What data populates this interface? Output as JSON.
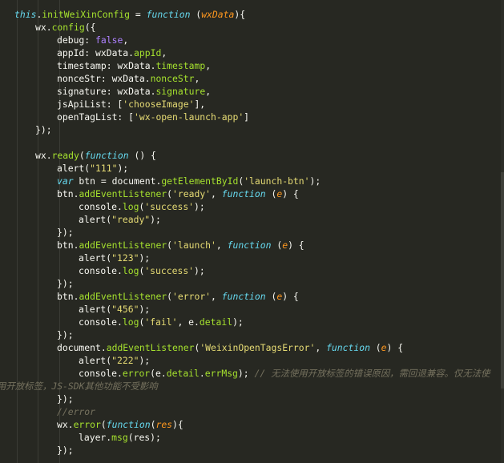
{
  "editor": {
    "theme_colors": {
      "background": "#272822",
      "keyword": "#66d9ef",
      "function": "#a6e22e",
      "string": "#e6db74",
      "boolean": "#ae81ff",
      "parameter": "#fd971f",
      "comment": "#75715e",
      "text": "#f8f8f2"
    },
    "lines": [
      {
        "indent": 0,
        "tokens": [
          [
            "kwi",
            "this"
          ],
          [
            "plain",
            "."
          ],
          [
            "fn",
            "initWeiXinConfig"
          ],
          [
            "plain",
            " = "
          ],
          [
            "kwi",
            "function"
          ],
          [
            "plain",
            " ("
          ],
          [
            "param",
            "wxData"
          ],
          [
            "plain",
            "){"
          ]
        ]
      },
      {
        "indent": 1,
        "tokens": [
          [
            "plain",
            "wx."
          ],
          [
            "fn",
            "config"
          ],
          [
            "plain",
            "({"
          ]
        ]
      },
      {
        "indent": 2,
        "tokens": [
          [
            "plain",
            "debug: "
          ],
          [
            "bool",
            "false"
          ],
          [
            "plain",
            ","
          ]
        ]
      },
      {
        "indent": 2,
        "tokens": [
          [
            "plain",
            "appId: wxData."
          ],
          [
            "prop",
            "appId"
          ],
          [
            "plain",
            ","
          ]
        ]
      },
      {
        "indent": 2,
        "tokens": [
          [
            "plain",
            "timestamp: wxData."
          ],
          [
            "prop",
            "timestamp"
          ],
          [
            "plain",
            ","
          ]
        ]
      },
      {
        "indent": 2,
        "tokens": [
          [
            "plain",
            "nonceStr: wxData."
          ],
          [
            "prop",
            "nonceStr"
          ],
          [
            "plain",
            ","
          ]
        ]
      },
      {
        "indent": 2,
        "tokens": [
          [
            "plain",
            "signature: wxData."
          ],
          [
            "prop",
            "signature"
          ],
          [
            "plain",
            ","
          ]
        ]
      },
      {
        "indent": 2,
        "tokens": [
          [
            "plain",
            "jsApiList: ["
          ],
          [
            "str",
            "'chooseImage'"
          ],
          [
            "plain",
            "],"
          ]
        ]
      },
      {
        "indent": 2,
        "tokens": [
          [
            "plain",
            "openTagList: ["
          ],
          [
            "str",
            "'wx-open-launch-app'"
          ],
          [
            "plain",
            "]"
          ]
        ]
      },
      {
        "indent": 1,
        "tokens": [
          [
            "plain",
            "});"
          ]
        ]
      },
      {
        "indent": 0,
        "tokens": []
      },
      {
        "indent": 1,
        "tokens": [
          [
            "plain",
            "wx."
          ],
          [
            "fn",
            "ready"
          ],
          [
            "plain",
            "("
          ],
          [
            "kwi",
            "function"
          ],
          [
            "plain",
            " () {"
          ]
        ]
      },
      {
        "indent": 2,
        "tokens": [
          [
            "plain",
            "alert("
          ],
          [
            "str",
            "\"111\""
          ],
          [
            "plain",
            ");"
          ]
        ]
      },
      {
        "indent": 2,
        "tokens": [
          [
            "kwi",
            "var"
          ],
          [
            "plain",
            " btn = document."
          ],
          [
            "fn",
            "getElementById"
          ],
          [
            "plain",
            "("
          ],
          [
            "str",
            "'launch-btn'"
          ],
          [
            "plain",
            ");"
          ]
        ]
      },
      {
        "indent": 2,
        "tokens": [
          [
            "plain",
            "btn."
          ],
          [
            "fn",
            "addEventListener"
          ],
          [
            "plain",
            "("
          ],
          [
            "str",
            "'ready'"
          ],
          [
            "plain",
            ", "
          ],
          [
            "kwi",
            "function"
          ],
          [
            "plain",
            " ("
          ],
          [
            "param",
            "e"
          ],
          [
            "plain",
            ") {"
          ]
        ]
      },
      {
        "indent": 3,
        "tokens": [
          [
            "plain",
            "console."
          ],
          [
            "fn",
            "log"
          ],
          [
            "plain",
            "("
          ],
          [
            "str",
            "'success'"
          ],
          [
            "plain",
            ");"
          ]
        ]
      },
      {
        "indent": 3,
        "tokens": [
          [
            "plain",
            "alert("
          ],
          [
            "str",
            "\"ready\""
          ],
          [
            "plain",
            ");"
          ]
        ]
      },
      {
        "indent": 2,
        "tokens": [
          [
            "plain",
            "});"
          ]
        ]
      },
      {
        "indent": 2,
        "tokens": [
          [
            "plain",
            "btn."
          ],
          [
            "fn",
            "addEventListener"
          ],
          [
            "plain",
            "("
          ],
          [
            "str",
            "'launch'"
          ],
          [
            "plain",
            ", "
          ],
          [
            "kwi",
            "function"
          ],
          [
            "plain",
            " ("
          ],
          [
            "param",
            "e"
          ],
          [
            "plain",
            ") {"
          ]
        ]
      },
      {
        "indent": 3,
        "tokens": [
          [
            "plain",
            "alert("
          ],
          [
            "str",
            "\"123\""
          ],
          [
            "plain",
            ");"
          ]
        ]
      },
      {
        "indent": 3,
        "tokens": [
          [
            "plain",
            "console."
          ],
          [
            "fn",
            "log"
          ],
          [
            "plain",
            "("
          ],
          [
            "str",
            "'success'"
          ],
          [
            "plain",
            ");"
          ]
        ]
      },
      {
        "indent": 2,
        "tokens": [
          [
            "plain",
            "});"
          ]
        ]
      },
      {
        "indent": 2,
        "tokens": [
          [
            "plain",
            "btn."
          ],
          [
            "fn",
            "addEventListener"
          ],
          [
            "plain",
            "("
          ],
          [
            "str",
            "'error'"
          ],
          [
            "plain",
            ", "
          ],
          [
            "kwi",
            "function"
          ],
          [
            "plain",
            " ("
          ],
          [
            "param",
            "e"
          ],
          [
            "plain",
            ") {"
          ]
        ]
      },
      {
        "indent": 3,
        "tokens": [
          [
            "plain",
            "alert("
          ],
          [
            "str",
            "\"456\""
          ],
          [
            "plain",
            ");"
          ]
        ]
      },
      {
        "indent": 3,
        "tokens": [
          [
            "plain",
            "console."
          ],
          [
            "fn",
            "log"
          ],
          [
            "plain",
            "("
          ],
          [
            "str",
            "'fail'"
          ],
          [
            "plain",
            ", e."
          ],
          [
            "prop",
            "detail"
          ],
          [
            "plain",
            ");"
          ]
        ]
      },
      {
        "indent": 2,
        "tokens": [
          [
            "plain",
            "});"
          ]
        ]
      },
      {
        "indent": 2,
        "tokens": [
          [
            "plain",
            "document."
          ],
          [
            "fn",
            "addEventListener"
          ],
          [
            "plain",
            "("
          ],
          [
            "str",
            "'WeixinOpenTagsError'"
          ],
          [
            "plain",
            ", "
          ],
          [
            "kwi",
            "function"
          ],
          [
            "plain",
            " ("
          ],
          [
            "param",
            "e"
          ],
          [
            "plain",
            ") {"
          ]
        ]
      },
      {
        "indent": 3,
        "tokens": [
          [
            "plain",
            "alert("
          ],
          [
            "str",
            "\"222\""
          ],
          [
            "plain",
            ");"
          ]
        ]
      },
      {
        "indent": 3,
        "tokens": [
          [
            "plain",
            "console."
          ],
          [
            "fn",
            "error"
          ],
          [
            "plain",
            "(e."
          ],
          [
            "prop",
            "detail"
          ],
          [
            "plain",
            "."
          ],
          [
            "prop",
            "errMsg"
          ],
          [
            "plain",
            "); "
          ],
          [
            "cmt",
            "// 无法使用开放标签的错误原因，需回退兼容。仅无法使"
          ]
        ]
      },
      {
        "indent": -1,
        "tokens": [
          [
            "cmt",
            "用开放标签，JS-SDK其他功能不受影响"
          ]
        ]
      },
      {
        "indent": 2,
        "tokens": [
          [
            "plain",
            "});"
          ]
        ]
      },
      {
        "indent": 2,
        "tokens": [
          [
            "cmt",
            "//error"
          ]
        ]
      },
      {
        "indent": 2,
        "tokens": [
          [
            "plain",
            "wx."
          ],
          [
            "fn",
            "error"
          ],
          [
            "plain",
            "("
          ],
          [
            "kwi",
            "function"
          ],
          [
            "plain",
            "("
          ],
          [
            "param",
            "res"
          ],
          [
            "plain",
            "){"
          ]
        ]
      },
      {
        "indent": 3,
        "tokens": [
          [
            "plain",
            "layer."
          ],
          [
            "fn",
            "msg"
          ],
          [
            "plain",
            "(res);"
          ]
        ]
      },
      {
        "indent": 2,
        "tokens": [
          [
            "plain",
            "});"
          ]
        ]
      }
    ]
  }
}
